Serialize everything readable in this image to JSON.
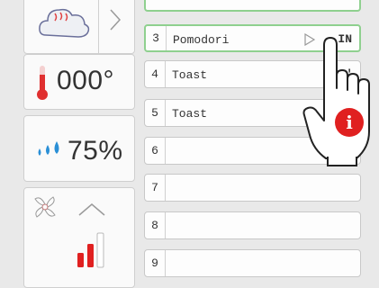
{
  "status": {
    "temperature": "000°",
    "humidity": "75%"
  },
  "recipes": [
    {
      "num": "3",
      "name": "Pomodori",
      "tail": "IN"
    },
    {
      "num": "4",
      "name": "Toast",
      "tail": "0'"
    },
    {
      "num": "5",
      "name": "Toast",
      "tail": ""
    },
    {
      "num": "6",
      "name": "",
      "tail": ""
    },
    {
      "num": "7",
      "name": "",
      "tail": ""
    },
    {
      "num": "8",
      "name": "",
      "tail": ""
    },
    {
      "num": "9",
      "name": "",
      "tail": ""
    }
  ],
  "icons": {
    "steam": "cloud-icon",
    "chevron": "chevron-right-icon",
    "thermometer": "thermometer-icon",
    "drops": "water-drops-icon",
    "fan": "fan-icon",
    "fan_up": "chevron-up-icon",
    "signal": "signal-bars-icon",
    "hand": "pointing-hand-icon",
    "info": "info-icon"
  },
  "colors": {
    "active_border": "#8fd08f",
    "thermo_red": "#e03030",
    "drops_blue": "#2a8fd6",
    "signal_red": "#e02020",
    "info_red": "#e02020"
  }
}
